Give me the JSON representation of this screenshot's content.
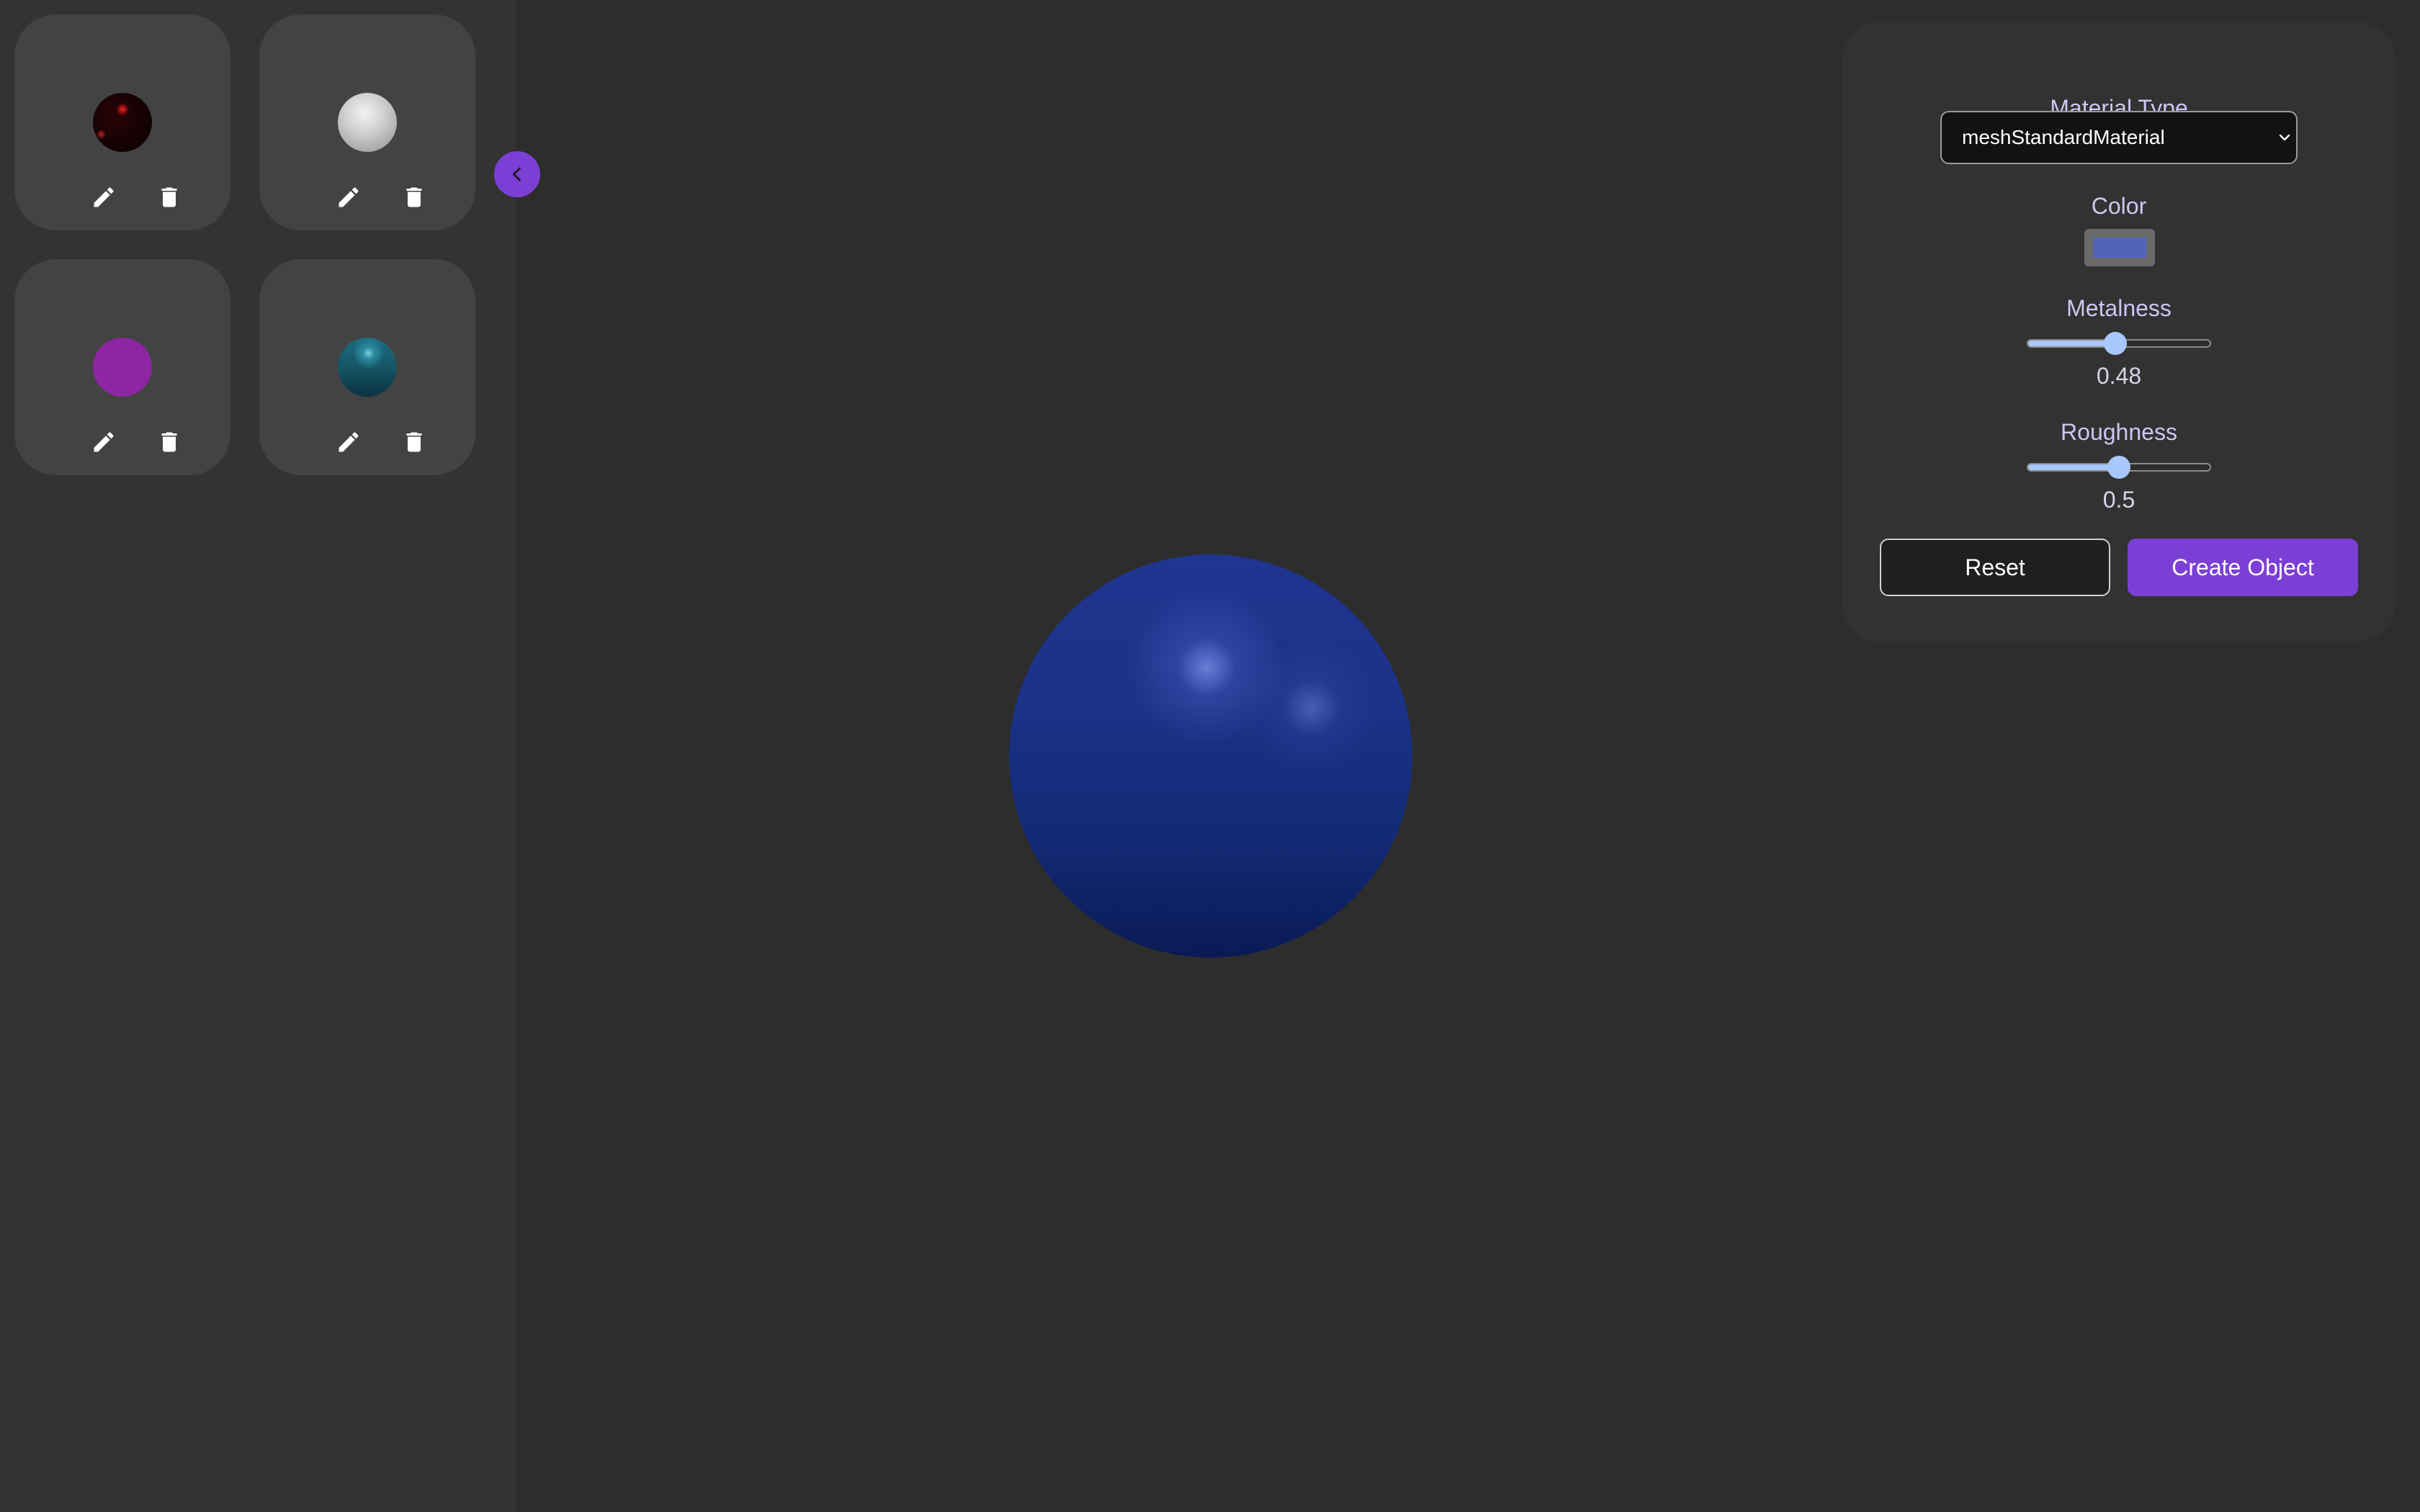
{
  "sidebar": {
    "cards": [
      {
        "thumb_icon": "dark-red-sphere",
        "edit_icon": "pencil-icon",
        "delete_icon": "trash-icon"
      },
      {
        "thumb_icon": "silver-sphere",
        "edit_icon": "pencil-icon",
        "delete_icon": "trash-icon"
      },
      {
        "thumb_icon": "purple-sphere",
        "edit_icon": "pencil-icon",
        "delete_icon": "trash-icon"
      },
      {
        "thumb_icon": "teal-sphere",
        "edit_icon": "pencil-icon",
        "delete_icon": "trash-icon"
      }
    ],
    "toggle_icon": "chevron-left-icon"
  },
  "panel": {
    "material_type_label": "Material Type",
    "material_type_value": "meshStandardMaterial",
    "color_label": "Color",
    "color_value": "#5263b8",
    "metalness_label": "Metalness",
    "metalness_value": "0.48",
    "metalness_fraction": 0.48,
    "roughness_label": "Roughness",
    "roughness_value": "0.5",
    "roughness_fraction": 0.5,
    "reset_label": "Reset",
    "create_label": "Create Object"
  },
  "colors": {
    "accent": "#7c3fd6",
    "slider": "#a8c7fa",
    "sphere": "#1c3288"
  }
}
